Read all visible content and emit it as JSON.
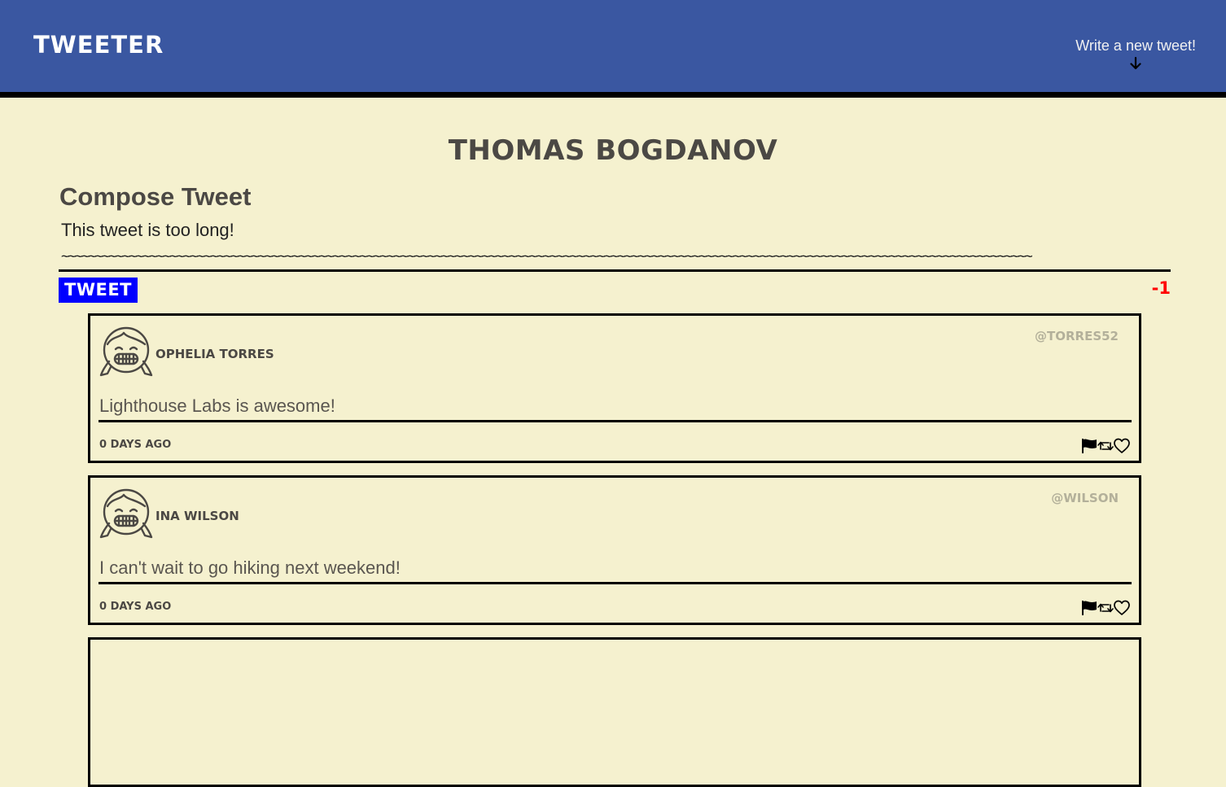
{
  "nav": {
    "brand": "TWEETER",
    "write_label": "Write a new tweet!"
  },
  "profile": {
    "name": "THOMAS BOGDANOV"
  },
  "compose": {
    "title": "Compose Tweet",
    "error": "This tweet is too long!",
    "text": "~~~~~~~~~~~~~~~~~~~~~~~~~~~~~~~~~~~~~~~~~~~~~~~~~~~~~~~~~~~~~~~~~~~~~~~~~~~~~~~~~~~~~~~~~~~~~~~~~~~~~~~~~~~~~~~~~~~~~~~~~~~~~~~~~~~~~~~~~~~~~~~",
    "button_label": "TWEET",
    "counter": "-1",
    "counter_color": "#ff0000",
    "button_color": "#0000ff"
  },
  "tweets": [
    {
      "name": "Ophelia Torres",
      "handle": "@torres52",
      "content": "Lighthouse Labs is awesome!",
      "age": "0 days ago",
      "avatar_icon": "smiling-girl-avatar-icon",
      "actions": [
        "flag-icon",
        "retweet-icon",
        "heart-icon"
      ]
    },
    {
      "name": "Ina Wilson",
      "handle": "@wilson",
      "content": "I can't wait to go hiking next weekend!",
      "age": "0 days ago",
      "avatar_icon": "smiling-girl-avatar-icon",
      "actions": [
        "flag-icon",
        "retweet-icon",
        "heart-icon"
      ]
    }
  ],
  "colors": {
    "header_bg": "#3a57a1",
    "page_bg": "#f5f1cf",
    "text_dark": "#4b4844",
    "handle": "#b3b09a"
  }
}
